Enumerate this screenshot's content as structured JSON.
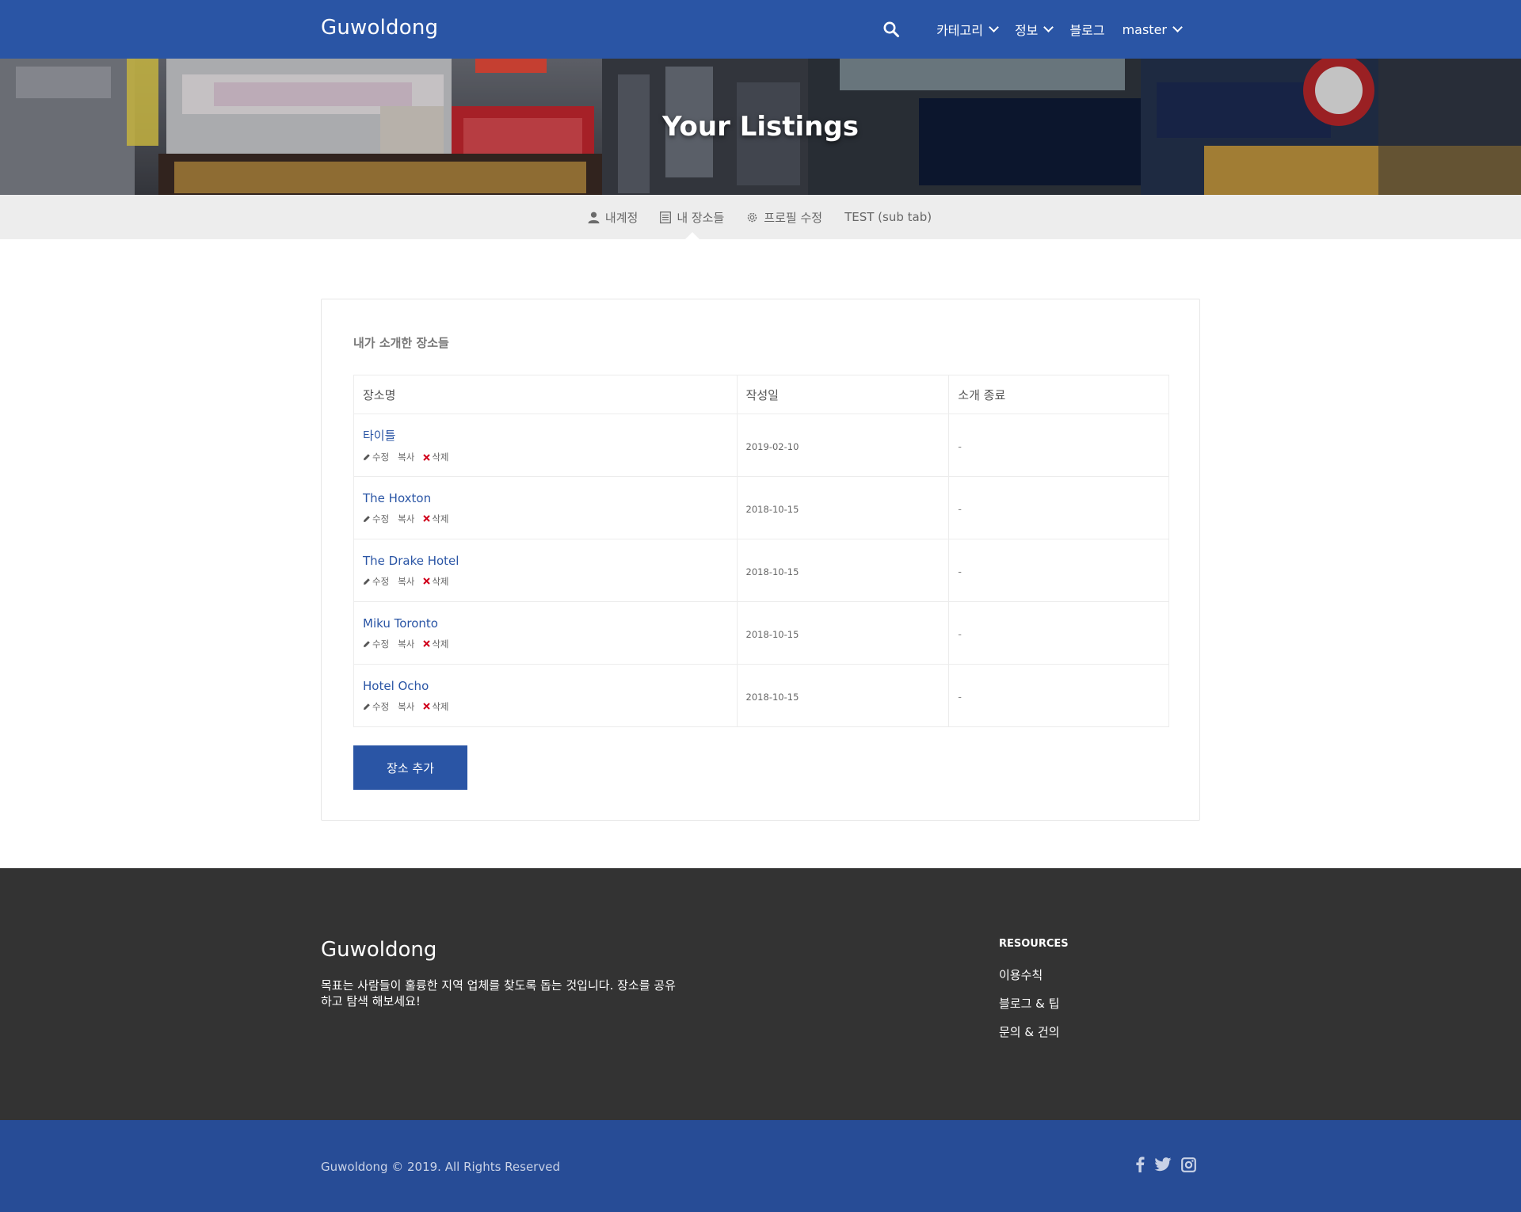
{
  "colors": {
    "primary": "#2a55a5",
    "footer_bg": "#333333",
    "bottom_bar": "#274c96",
    "delete_red": "#d0021b"
  },
  "nav": {
    "brand": "Guwoldong",
    "items": [
      {
        "label": "카테고리",
        "has_dropdown": true
      },
      {
        "label": "정보",
        "has_dropdown": true
      },
      {
        "label": "블로그",
        "has_dropdown": false
      },
      {
        "label": "master",
        "has_dropdown": true
      }
    ],
    "search_icon": "search-icon"
  },
  "hero": {
    "title": "Your Listings"
  },
  "subtabs": [
    {
      "label": "내계정",
      "icon": "user-icon"
    },
    {
      "label": "내 장소들",
      "icon": "list-icon",
      "active": true
    },
    {
      "label": "프로필 수정",
      "icon": "gear-icon"
    },
    {
      "label": "TEST (sub tab)",
      "icon": ""
    }
  ],
  "listings": {
    "title": "내가 소개한 장소들",
    "headers": [
      "장소명",
      "작성일",
      "소개 종료"
    ],
    "actions": {
      "edit": "수정",
      "copy": "복사",
      "delete": "삭제"
    },
    "rows": [
      {
        "name": "타이틀",
        "date": "2019-02-10",
        "end": "-"
      },
      {
        "name": "The Hoxton",
        "date": "2018-10-15",
        "end": "-"
      },
      {
        "name": "The Drake Hotel",
        "date": "2018-10-15",
        "end": "-"
      },
      {
        "name": "Miku Toronto",
        "date": "2018-10-15",
        "end": "-"
      },
      {
        "name": "Hotel Ocho",
        "date": "2018-10-15",
        "end": "-"
      }
    ],
    "add_button": "장소 추가"
  },
  "footer": {
    "brand": "Guwoldong",
    "description": "목표는 사람들이 훌륭한 지역 업체를 찾도록 돕는 것입니다. 장소를 공유하고 탐색 해보세요!",
    "resources_title": "RESOURCES",
    "links": [
      "이용수칙",
      "블로그 & 팁",
      "문의 & 건의"
    ],
    "copyright": "Guwoldong © 2019. All Rights Reserved",
    "socials": [
      "facebook-icon",
      "twitter-icon",
      "instagram-icon"
    ]
  }
}
